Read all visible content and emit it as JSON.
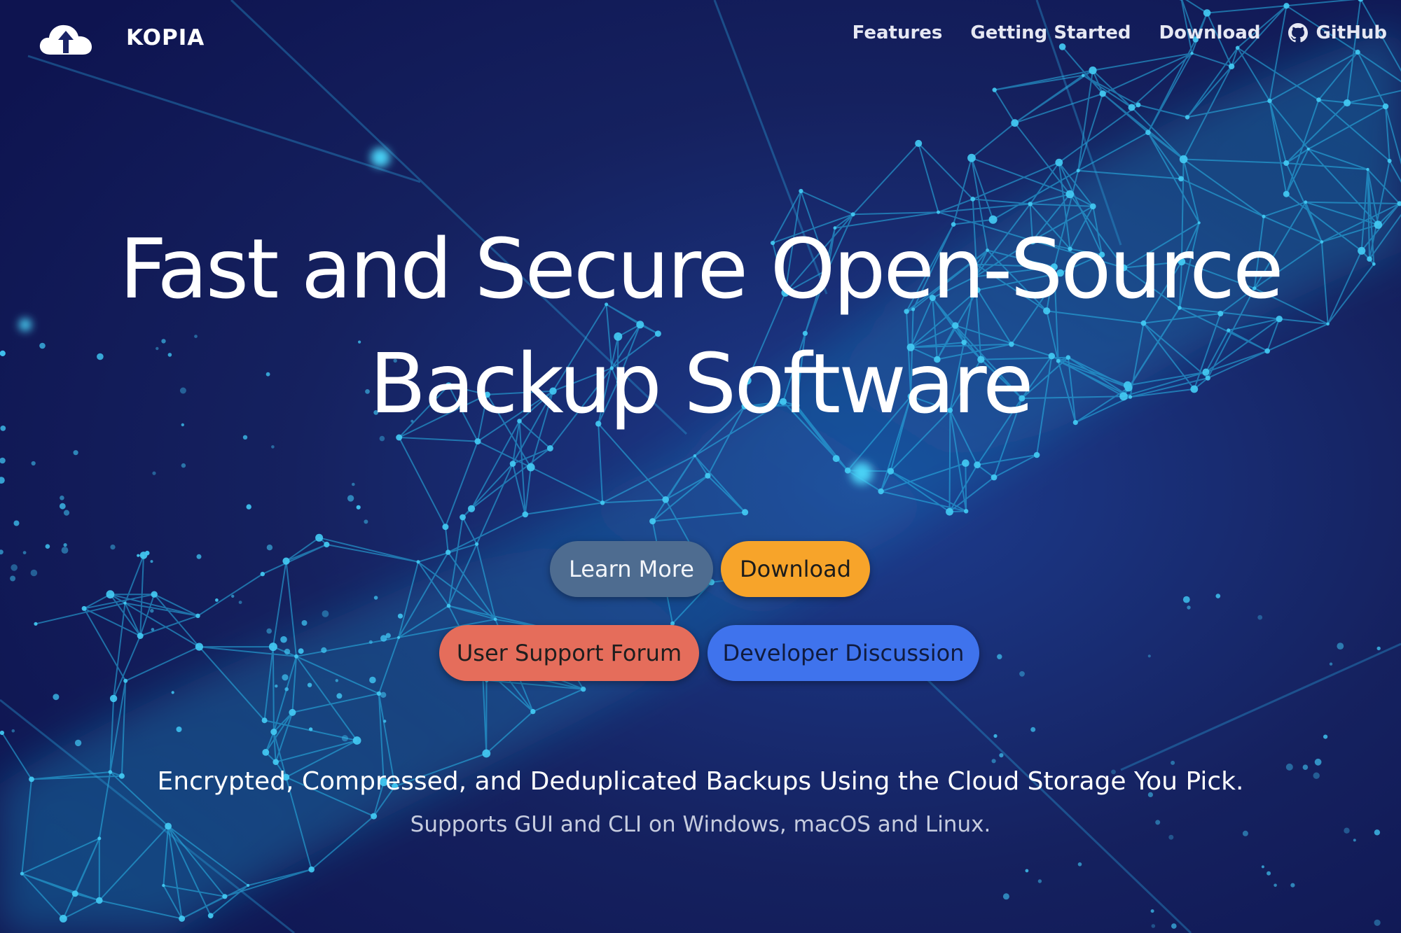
{
  "navbar": {
    "brand": {
      "name": "KOPIA",
      "icon": "cloud-upload-icon"
    },
    "links": [
      {
        "label": "Features"
      },
      {
        "label": "Getting Started"
      },
      {
        "label": "Download"
      },
      {
        "label": "GitHub",
        "icon": "github-icon"
      }
    ]
  },
  "hero": {
    "title_line1": "Fast and Secure Open-Source",
    "title_line2": "Backup Software",
    "buttons": [
      {
        "label": "Learn More",
        "color": "#4e6c90"
      },
      {
        "label": "Download",
        "color": "#f7a42a"
      },
      {
        "label": "User Support Forum",
        "color": "#e56d5b"
      },
      {
        "label": "Developer Discussion",
        "color": "#3f73ed"
      }
    ],
    "tagline": "Encrypted, Compressed, and Deduplicated Backups Using the Cloud Storage You Pick.",
    "subtagline": "Supports GUI and CLI on Windows, macOS and Linux."
  },
  "colors": {
    "background": "#12175a",
    "network_accent": "#29b6e8"
  }
}
